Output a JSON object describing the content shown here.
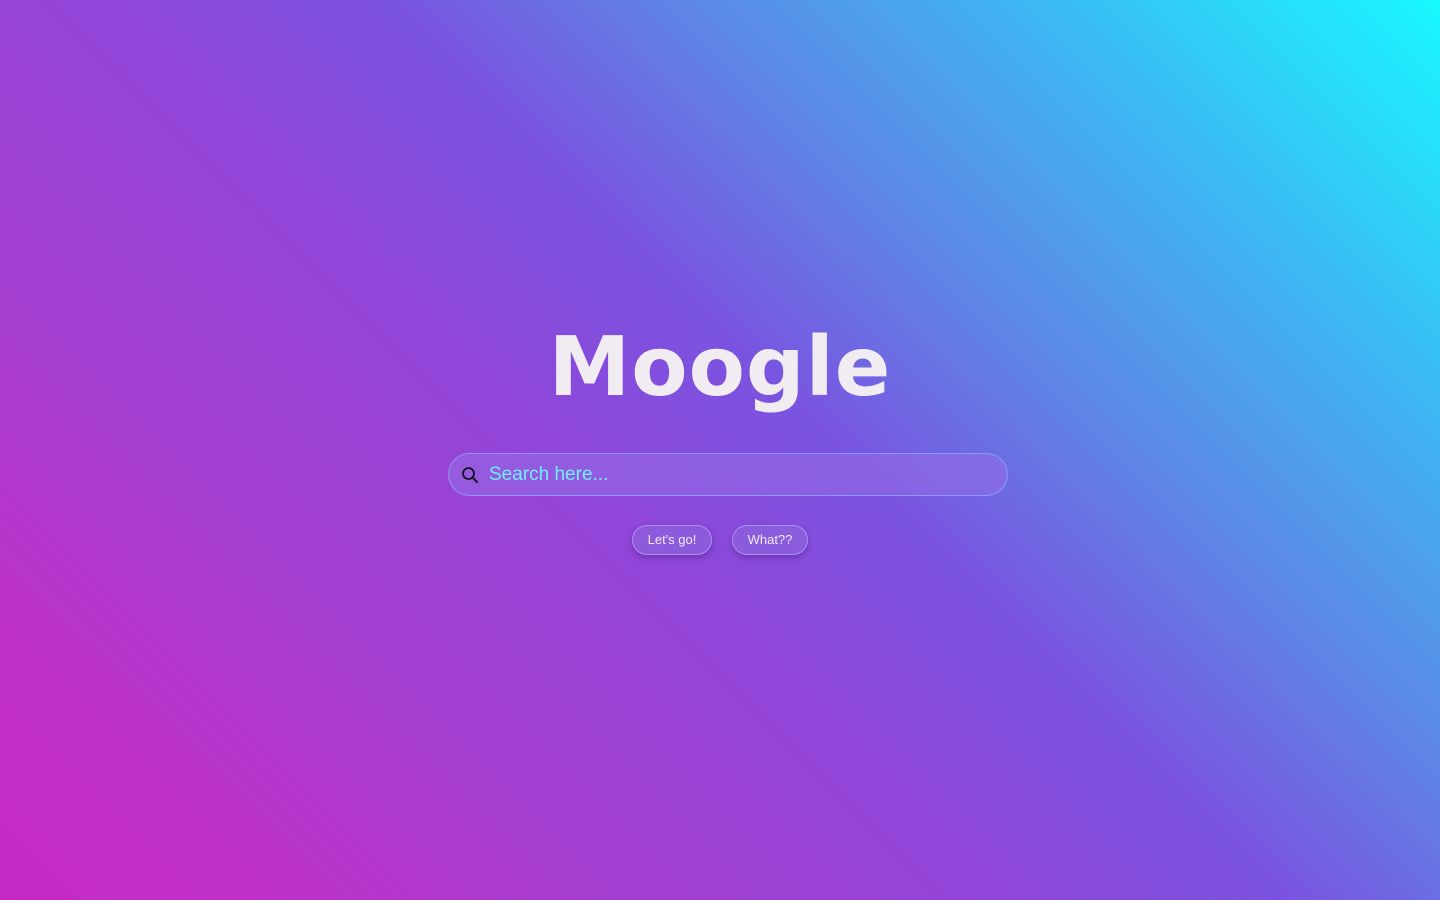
{
  "brand": {
    "logo_text": "Moogle"
  },
  "search": {
    "placeholder": "Search here...",
    "value": "",
    "icon": "search-icon"
  },
  "actions": {
    "submit_label": "Let's go!",
    "lucky_label": "What??"
  },
  "colors": {
    "gradient_start": "#c52ac6",
    "gradient_mid": "#7a53e0",
    "gradient_end": "#18f8ff",
    "logo": "#f1ecf2",
    "search_text": "#6ff0ff"
  }
}
